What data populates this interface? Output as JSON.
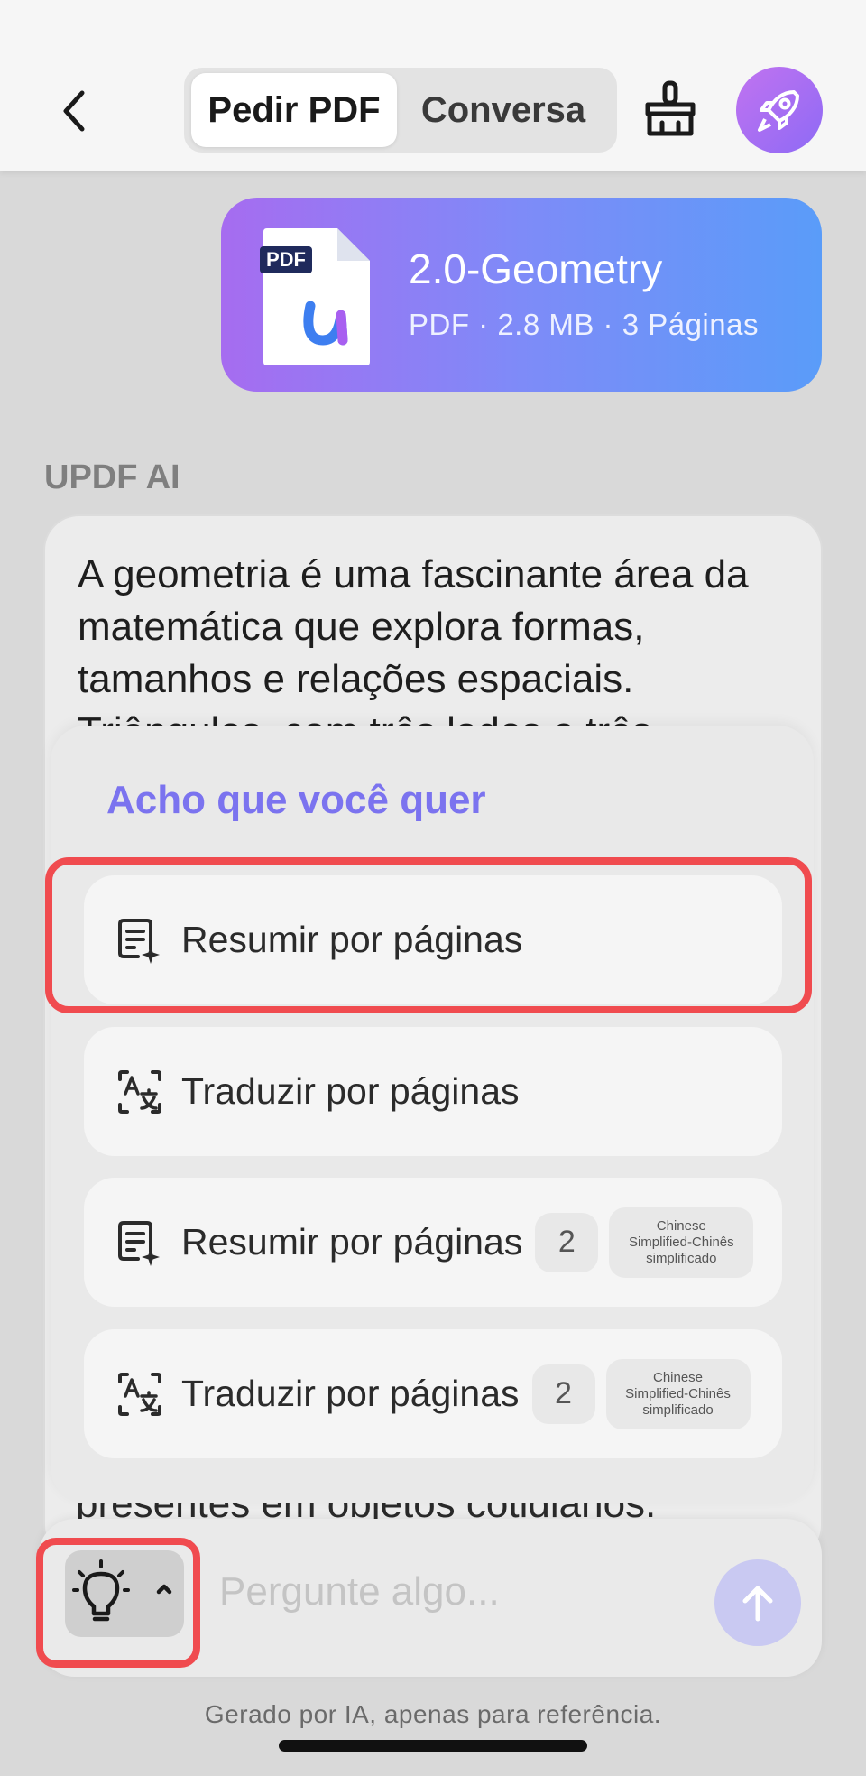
{
  "header": {
    "back_icon": "chevron-left-icon",
    "tabs": [
      {
        "label": "Pedir PDF",
        "active": true
      },
      {
        "label": "Conversa",
        "active": false
      }
    ],
    "clear_icon": "broom-icon",
    "upgrade_icon": "rocket-icon"
  },
  "file": {
    "badge": "PDF",
    "name": "2.0-Geometry",
    "meta": "PDF · 2.8 MB · 3 Páginas"
  },
  "ai": {
    "label": "UPDF AI",
    "text": "A geometria é uma fascinante área da matemática que explora formas, tamanhos e relações espaciais. Triângulos, com três lados e três",
    "tail": "presentes em objetos cotidianos."
  },
  "suggestions": {
    "title": "Acho que você quer",
    "items": [
      {
        "label": "Resumir por páginas",
        "icon": "summarize-icon",
        "count": "",
        "language": ""
      },
      {
        "label": "Traduzir por páginas",
        "icon": "translate-icon",
        "count": "",
        "language": ""
      },
      {
        "label": "Resumir por páginas",
        "icon": "summarize-icon",
        "count": "2",
        "language": [
          "Chinese",
          "Simplified-Chinês",
          "simplificado"
        ]
      },
      {
        "label": "Traduzir por páginas",
        "icon": "translate-icon",
        "count": "2",
        "language": [
          "Chinese",
          "Simplified-Chinês",
          "simplificado"
        ]
      }
    ]
  },
  "input": {
    "placeholder": "Pergunte algo...",
    "prompt_icon": "lightbulb-icon",
    "send_icon": "arrow-up-icon"
  },
  "footer": {
    "note": "Gerado por IA, apenas para referência."
  },
  "colors": {
    "accent": "#7b73ef",
    "highlight": "#f04b4f",
    "card_gradient_start": "#a66cf0",
    "card_gradient_end": "#5a9cf9"
  }
}
